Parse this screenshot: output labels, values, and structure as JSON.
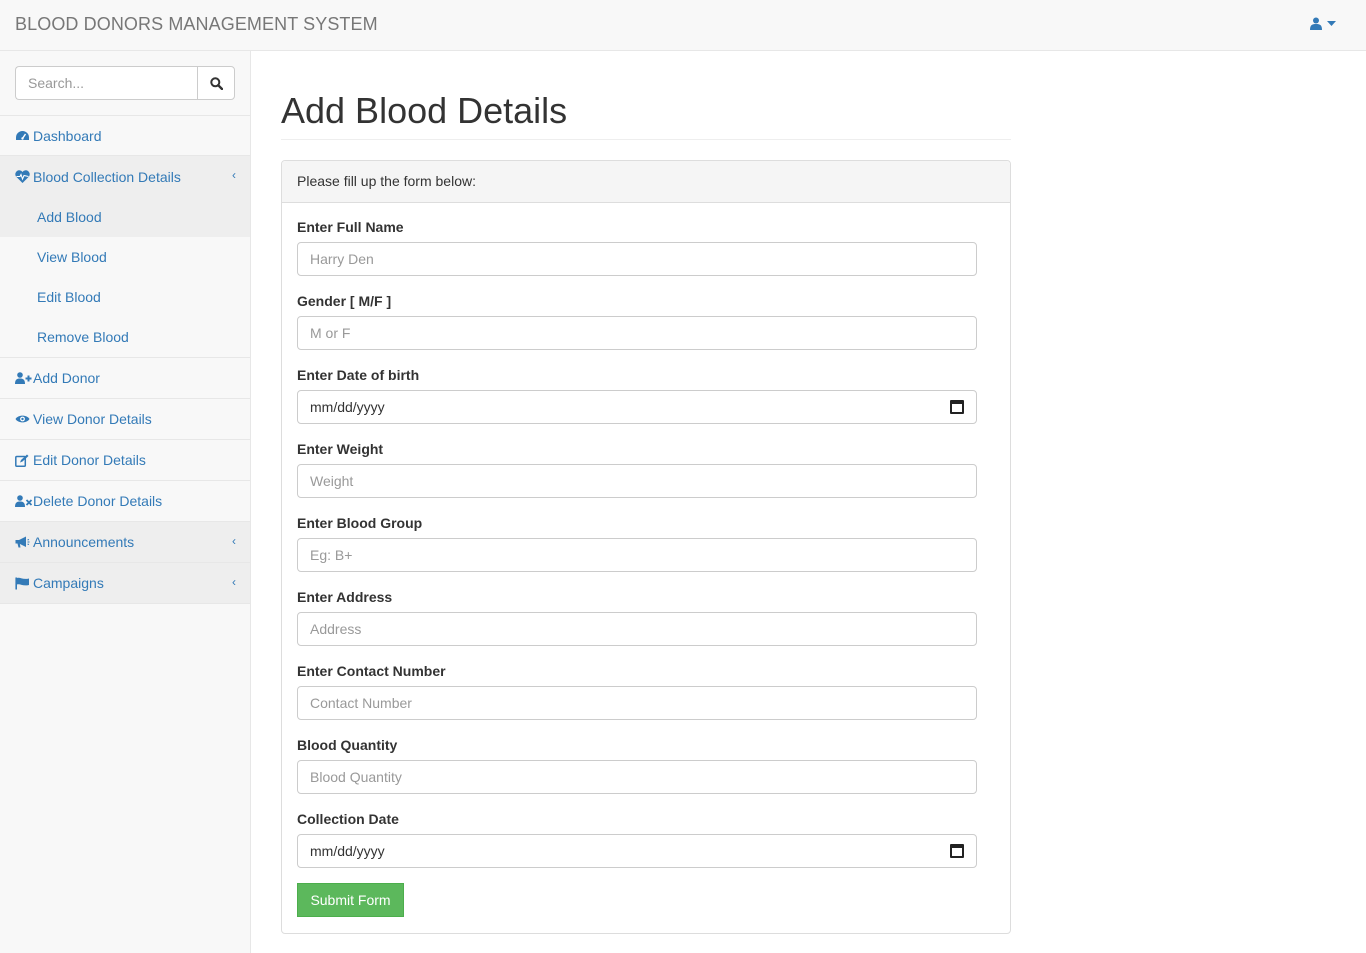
{
  "app": {
    "brand": "BLOOD DONORS MANAGEMENT SYSTEM"
  },
  "search": {
    "placeholder": "Search..."
  },
  "sidebar": {
    "dashboard": "Dashboard",
    "blood_collection": "Blood Collection Details",
    "blood_sub": [
      "Add Blood",
      "View Blood",
      "Edit Blood",
      "Remove Blood"
    ],
    "add_donor": "Add Donor",
    "view_donor": "View Donor Details",
    "edit_donor": "Edit Donor Details",
    "delete_donor": "Delete Donor Details",
    "announcements": "Announcements",
    "campaigns": "Campaigns"
  },
  "page": {
    "title": "Add Blood Details",
    "panel_heading": "Please fill up the form below:"
  },
  "form": {
    "fields": [
      {
        "label": "Enter Full Name",
        "placeholder": "Harry Den"
      },
      {
        "label": "Gender [ M/F ]",
        "placeholder": "M or F"
      },
      {
        "label": "Enter Date of birth",
        "value": "mm/dd/yyyy"
      },
      {
        "label": "Enter Weight",
        "placeholder": "Weight"
      },
      {
        "label": "Enter Blood Group",
        "placeholder": "Eg: B+"
      },
      {
        "label": "Enter Address",
        "placeholder": "Address"
      },
      {
        "label": "Enter Contact Number",
        "placeholder": "Contact Number"
      },
      {
        "label": "Blood Quantity",
        "placeholder": "Blood Quantity"
      },
      {
        "label": "Collection Date",
        "value": "mm/dd/yyyy"
      }
    ],
    "submit_label": "Submit Form"
  },
  "colors": {
    "link": "#337ab7",
    "submit": "#5cb85c"
  },
  "icons": [
    "user-icon",
    "search-icon",
    "dashboard-icon",
    "heartbeat-icon",
    "user-plus-icon",
    "eye-icon",
    "edit-icon",
    "user-times-icon",
    "bullhorn-icon",
    "flag-icon",
    "calendar-icon"
  ]
}
